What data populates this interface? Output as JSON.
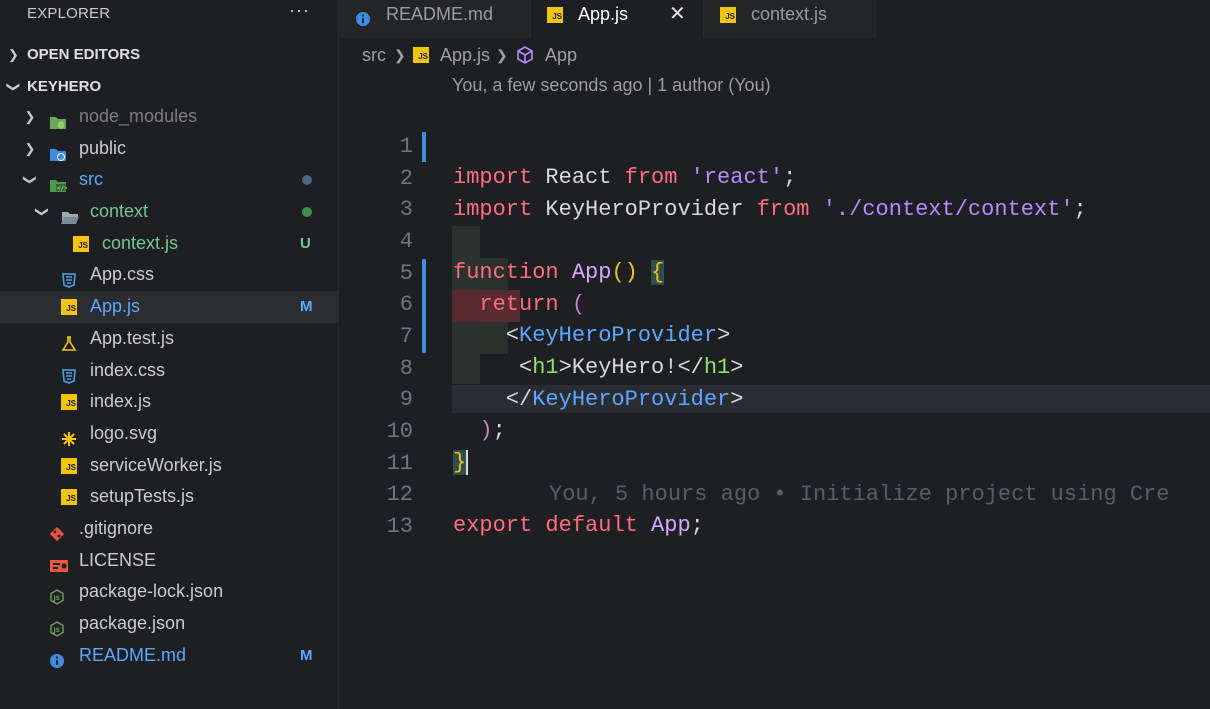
{
  "sidebar": {
    "title": "EXPLORER",
    "more": "···",
    "sections": [
      {
        "label": "OPEN EDITORS"
      },
      {
        "label": "KEYHERO"
      }
    ],
    "tree": [
      {
        "label": "node_modules",
        "badge": ""
      },
      {
        "label": "public",
        "badge": ""
      },
      {
        "label": "src",
        "badge": ""
      },
      {
        "label": "context",
        "badge": ""
      },
      {
        "label": "context.js",
        "badge": "U"
      },
      {
        "label": "App.css",
        "badge": ""
      },
      {
        "label": "App.js",
        "badge": "M"
      },
      {
        "label": "App.test.js",
        "badge": ""
      },
      {
        "label": "index.css",
        "badge": ""
      },
      {
        "label": "index.js",
        "badge": ""
      },
      {
        "label": "logo.svg",
        "badge": ""
      },
      {
        "label": "serviceWorker.js",
        "badge": ""
      },
      {
        "label": "setupTests.js",
        "badge": ""
      },
      {
        "label": ".gitignore",
        "badge": ""
      },
      {
        "label": "LICENSE",
        "badge": ""
      },
      {
        "label": "package-lock.json",
        "badge": ""
      },
      {
        "label": "package.json",
        "badge": ""
      },
      {
        "label": "README.md",
        "badge": "M"
      }
    ]
  },
  "tabs": [
    {
      "label": "README.md",
      "icon": "info-icon"
    },
    {
      "label": "App.js",
      "icon": "js-file-icon",
      "active": true
    },
    {
      "label": "context.js",
      "icon": "js-file-icon"
    }
  ],
  "breadcrumb": [
    "src",
    "App.js",
    "App"
  ],
  "editor": {
    "codelens": "You, a few seconds ago | 1 author (You)",
    "line_numbers": [
      "1",
      "2",
      "3",
      "4",
      "5",
      "6",
      "7",
      "8",
      "9",
      "10",
      "11",
      "12",
      "13"
    ],
    "blame": "You, 5 hours ago • Initialize project using Cre"
  },
  "colors": {
    "accent": "#3b8de0",
    "untracked": "#73c991",
    "modified": "#5aa8ff"
  }
}
